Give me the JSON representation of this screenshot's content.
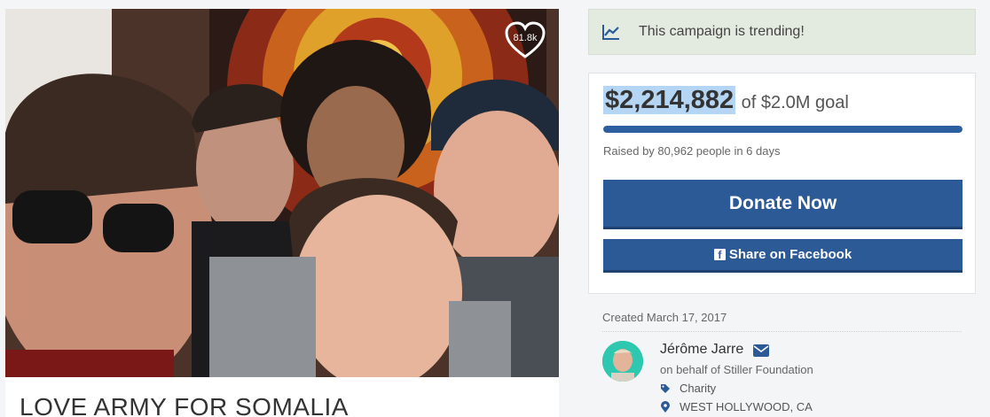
{
  "photo": {
    "likes_count": "81.8k",
    "campaign_title": "LOVE ARMY FOR SOMALIA"
  },
  "trending": {
    "icon": "trend-chart-icon",
    "text": "This campaign is trending!"
  },
  "donation": {
    "amount_raised": "$2,214,882",
    "goal_text": "of $2.0M goal",
    "progress_fraction": 1.0,
    "raised_by_text": "Raised by 80,962 people in 6 days",
    "donate_label": "Donate Now",
    "share_label": "Share on Facebook",
    "facebook_icon": "facebook-icon"
  },
  "organizer": {
    "created_text": "Created March 17, 2017",
    "name": "Jérôme Jarre",
    "behalf_text": "on behalf of Stiller Foundation",
    "category": "Charity",
    "location": "WEST HOLLYWOOD, CA"
  },
  "colors": {
    "brand_blue": "#2c5a97",
    "trending_bg": "#e3eae0",
    "progress_fill": "#2c5fa0",
    "selection_highlight": "#b5d5f5"
  }
}
